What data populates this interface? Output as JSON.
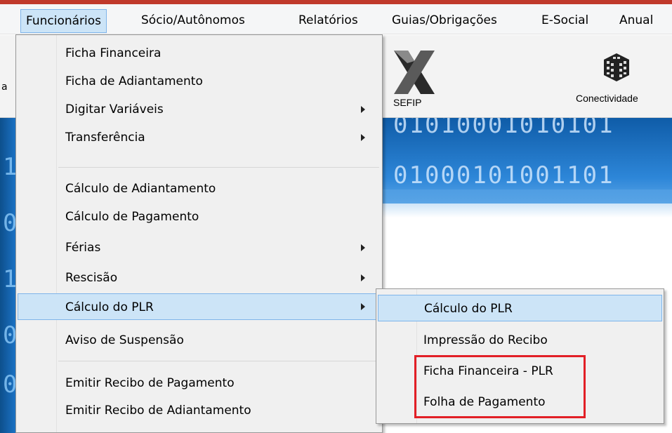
{
  "menubar": {
    "items": [
      "Funcionários",
      "Sócio/Autônomos",
      "Relatórios",
      "Guias/Obrigações",
      "E-Social",
      "Anual"
    ]
  },
  "toolbar": {
    "partial_label": "a",
    "sefip_label": "SEFIP",
    "conectividade_label": "Conectividade",
    "icons": [
      "sefip-x-icon",
      "conectividade-cube-icon"
    ]
  },
  "background": {
    "binary_line_1": "01010001010101",
    "binary_line_2": "01000101001101",
    "strip_glyphs": [
      "1",
      "0",
      "1",
      "0",
      "0"
    ]
  },
  "funcionarios_menu": {
    "items": [
      {
        "label": "Ficha Financeira",
        "submenu": false
      },
      {
        "label": "Ficha de Adiantamento",
        "submenu": false
      },
      {
        "label": "Digitar Variáveis",
        "submenu": true
      },
      {
        "label": "Transferência",
        "submenu": true
      },
      {
        "label": "Cálculo de Adiantamento",
        "submenu": false
      },
      {
        "label": "Cálculo de Pagamento",
        "submenu": false
      },
      {
        "label": "Férias",
        "submenu": true
      },
      {
        "label": "Rescisão",
        "submenu": true
      },
      {
        "label": "Cálculo do PLR",
        "submenu": true,
        "highlighted": true
      },
      {
        "label": "Aviso de Suspensão",
        "submenu": false
      },
      {
        "label": "Emitir Recibo de Pagamento",
        "submenu": false
      },
      {
        "label": "Emitir Recibo de Adiantamento",
        "submenu": false
      }
    ]
  },
  "plr_submenu": {
    "items": [
      {
        "label": "Cálculo do PLR",
        "highlighted": true
      },
      {
        "label": "Impressão do Recibo"
      },
      {
        "label": "Ficha Financeira - PLR"
      },
      {
        "label": "Folha de Pagamento"
      }
    ]
  },
  "colors": {
    "highlight": "#cce4f7",
    "highlight_border": "#7eb4ea",
    "annotation": "#e21f26",
    "menu_bg": "#f0f0f0"
  }
}
